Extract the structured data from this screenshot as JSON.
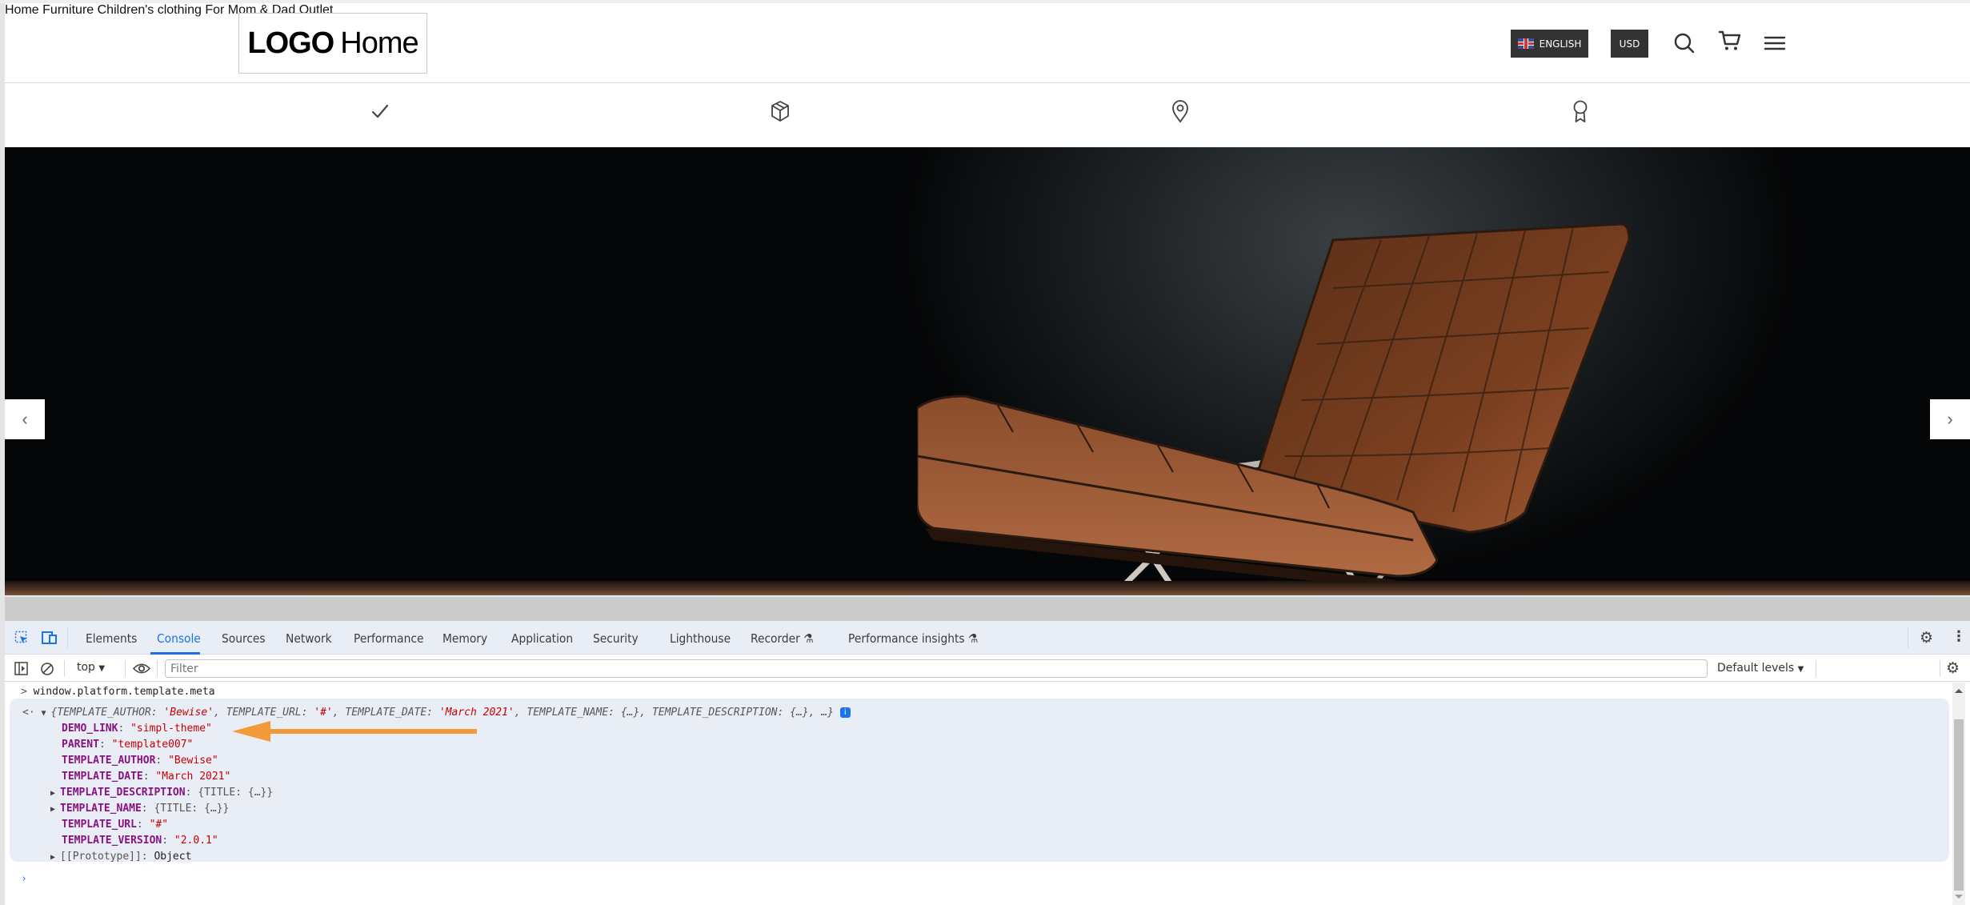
{
  "header": {
    "logo_bold": "LOGO",
    "logo_light": "Home",
    "nav": [
      {
        "label": "Home"
      },
      {
        "label": "Furniture"
      },
      {
        "label": "Children's clothing"
      },
      {
        "label": "For Mom & Dad"
      },
      {
        "label": "Outlet"
      }
    ],
    "language_label": "ENGLISH",
    "language_icon": "uk-flag-icon",
    "currency_label": "USD",
    "icons": [
      "search-icon",
      "cart-icon",
      "menu-icon"
    ]
  },
  "features": {
    "icons": [
      "check-icon",
      "box-icon",
      "location-pin-icon",
      "award-ribbon-icon"
    ]
  },
  "hero": {
    "image": "leather-lounge-chair",
    "prev_label": "‹",
    "next_label": "›",
    "colors": {
      "leather": "#8a4a2a",
      "frame": "#c9c2ba",
      "background": "#101315"
    }
  },
  "devtools": {
    "tabs": [
      {
        "label": "Elements",
        "active": false
      },
      {
        "label": "Console",
        "active": true
      },
      {
        "label": "Sources",
        "active": false
      },
      {
        "label": "Network",
        "active": false
      },
      {
        "label": "Performance",
        "active": false
      },
      {
        "label": "Memory",
        "active": false
      },
      {
        "label": "Application",
        "active": false
      },
      {
        "label": "Security",
        "active": false
      },
      {
        "label": "Lighthouse",
        "active": false
      },
      {
        "label": "Recorder",
        "active": false,
        "experimental": true
      },
      {
        "label": "Performance insights",
        "active": false,
        "experimental": true
      }
    ],
    "context_selector": "top",
    "filter_placeholder": "Filter",
    "levels_label": "Default levels",
    "accent_color": "#1a73e8",
    "console": {
      "input": "window.platform.template.meta",
      "preview": {
        "open": "{",
        "entries": [
          {
            "key": "TEMPLATE_AUTHOR",
            "value": "'Bewise'"
          },
          {
            "key": "TEMPLATE_URL",
            "value": "'#'"
          },
          {
            "key": "TEMPLATE_DATE",
            "value": "'March 2021'"
          },
          {
            "key": "TEMPLATE_NAME",
            "value": "{…}"
          },
          {
            "key": "TEMPLATE_DESCRIPTION",
            "value": "{…}"
          }
        ],
        "tail": "…}"
      },
      "properties": [
        {
          "key": "DEMO_LINK",
          "value": "\"simpl-theme\"",
          "expandable": false,
          "highlighted": true
        },
        {
          "key": "PARENT",
          "value": "\"template007\"",
          "expandable": false
        },
        {
          "key": "TEMPLATE_AUTHOR",
          "value": "\"Bewise\"",
          "expandable": false
        },
        {
          "key": "TEMPLATE_DATE",
          "value": "\"March 2021\"",
          "expandable": false
        },
        {
          "key": "TEMPLATE_DESCRIPTION",
          "value": "{TITLE: {…}}",
          "expandable": true
        },
        {
          "key": "TEMPLATE_NAME",
          "value": "{TITLE: {…}}",
          "expandable": true
        },
        {
          "key": "TEMPLATE_URL",
          "value": "\"#\"",
          "expandable": false
        },
        {
          "key": "TEMPLATE_VERSION",
          "value": "\"2.0.1\"",
          "expandable": false
        }
      ],
      "prototype_key": "[[Prototype]]",
      "prototype_value": "Object",
      "annotation_color": "#f29a38"
    }
  }
}
